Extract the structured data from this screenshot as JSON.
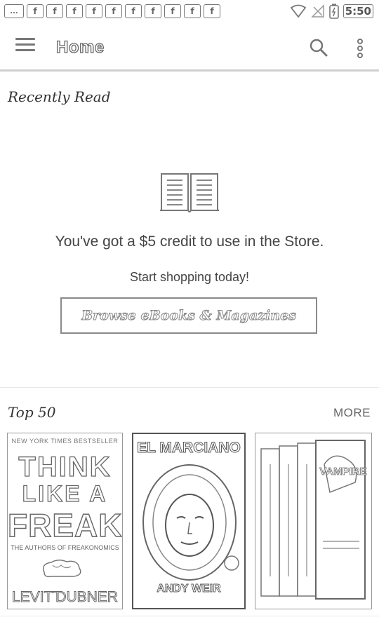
{
  "status_bar": {
    "notification_first": "...",
    "notifications": [
      "f",
      "f",
      "f",
      "f",
      "f",
      "f",
      "f",
      "f",
      "f",
      "f"
    ],
    "time": "5:50"
  },
  "app_bar": {
    "title": "Home"
  },
  "recently_read": {
    "title": "Recently Read",
    "promo_message": "You've got a $5 credit to use in the Store.",
    "promo_sub": "Start shopping today!",
    "browse_button_label": "Browse eBooks & Magazines"
  },
  "top50": {
    "title": "Top 50",
    "more_label": "MORE",
    "books": [
      {
        "banner": "NEW YORK TIMES BESTSELLER",
        "title_lines": [
          "THINK",
          "LIKE A",
          "FREAK"
        ],
        "subtitle": "THE AUTHORS OF FREAKONOMICS",
        "authors_left": "LEVITT",
        "authors_right": "DUBNER"
      },
      {
        "title": "EL MARCIANO",
        "author": "ANDY WEIR"
      },
      {
        "title": "VAMPIRE"
      }
    ]
  }
}
